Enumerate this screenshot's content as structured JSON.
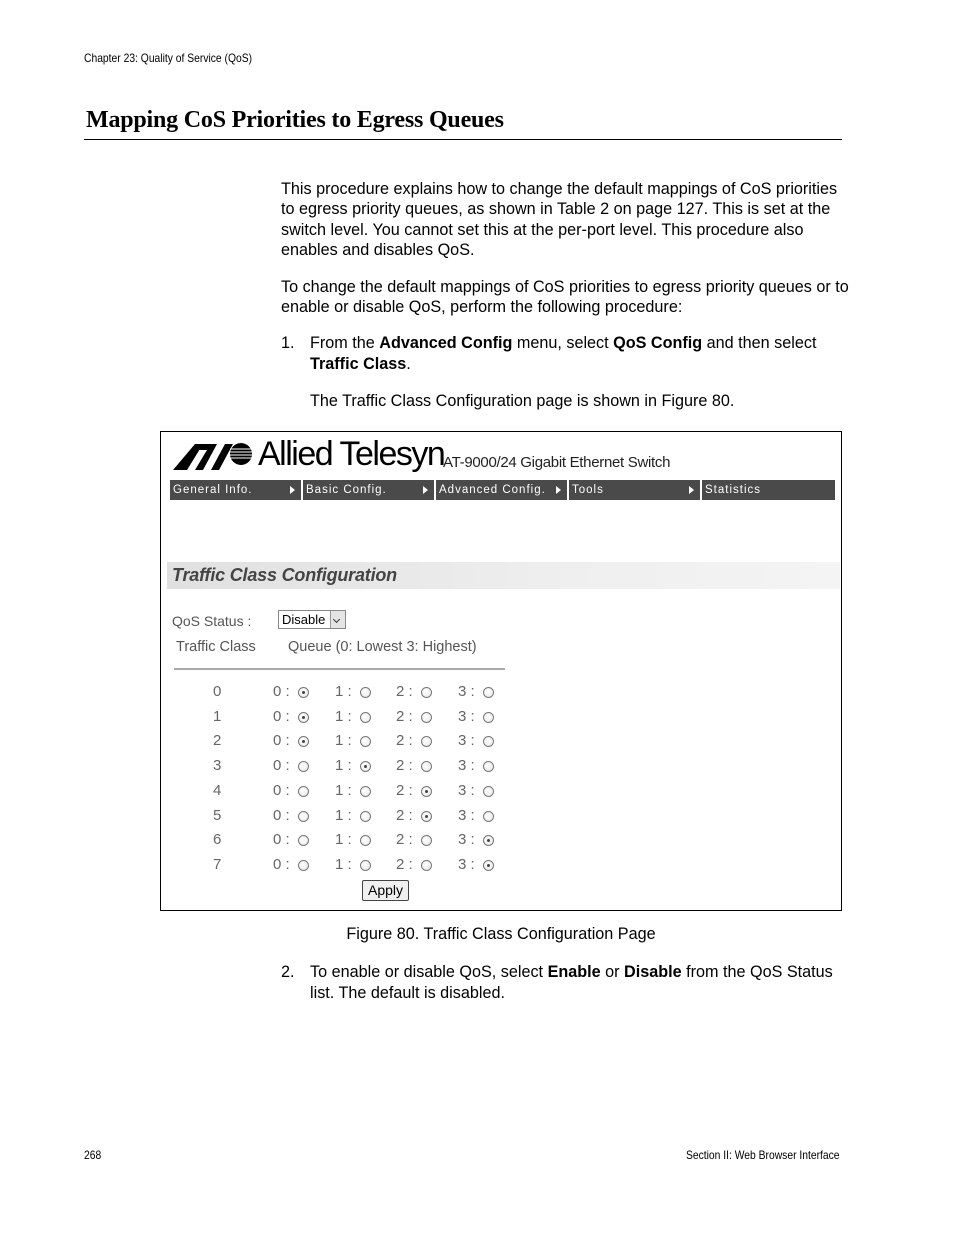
{
  "page": {
    "running_header": "Chapter 23: Quality of Service (QoS)",
    "section_title": "Mapping CoS Priorities to Egress Queues",
    "paragraphs": [
      "This procedure explains how to change the default mappings of CoS priorities to egress priority queues, as shown in Table 2 on page 127. This is set at the switch level. You cannot set this at the per-port level. This procedure also enables and disables QoS.",
      "To change the default mappings of CoS priorities to egress priority queues or to enable or disable QoS, perform the following procedure:"
    ],
    "steps": [
      {
        "number": "1.",
        "parts": [
          {
            "text": "From the ",
            "bold": false
          },
          {
            "text": "Advanced Config",
            "bold": true
          },
          {
            "text": " menu, select ",
            "bold": false
          },
          {
            "text": "QoS Config",
            "bold": true
          },
          {
            "text": " and then select ",
            "bold": false
          },
          {
            "text": "Traffic Class",
            "bold": true
          },
          {
            "text": ".",
            "bold": false
          }
        ],
        "followup": "The Traffic Class Configuration page is shown in Figure 80."
      },
      {
        "number": "2.",
        "parts": [
          {
            "text": "To enable or disable QoS, select ",
            "bold": false
          },
          {
            "text": "Enable",
            "bold": true
          },
          {
            "text": " or ",
            "bold": false
          },
          {
            "text": "Disable",
            "bold": true
          },
          {
            "text": " from the QoS Status list. The default is disabled.",
            "bold": false
          }
        ]
      }
    ],
    "figure_caption": "Figure 80. Traffic Class Configuration Page",
    "footer_left": "268",
    "footer_right": "Section II: Web Browser Interface"
  },
  "figure": {
    "brand": "Allied Telesyn",
    "product": "AT-9000/24 Gigabit Ethernet Switch",
    "nav": [
      {
        "label": "General Info.",
        "has_arrow": true
      },
      {
        "label": "Basic Config.",
        "has_arrow": true
      },
      {
        "label": "Advanced Config.",
        "has_arrow": true
      },
      {
        "label": "Tools",
        "has_arrow": true
      },
      {
        "label": "Statistics",
        "has_arrow": false
      }
    ],
    "panel_title": "Traffic Class Configuration",
    "qos_status_label": "QoS Status :",
    "qos_status_value": "Disable",
    "col_traffic_class": "Traffic Class",
    "col_queue": "Queue  (0: Lowest 3: Highest)",
    "queue_labels": [
      "0 :",
      "1 :",
      "2 :",
      "3 :"
    ],
    "rows": [
      {
        "traffic_class": "0",
        "selected_queue": 0
      },
      {
        "traffic_class": "1",
        "selected_queue": 0
      },
      {
        "traffic_class": "2",
        "selected_queue": 0
      },
      {
        "traffic_class": "3",
        "selected_queue": 1
      },
      {
        "traffic_class": "4",
        "selected_queue": 2
      },
      {
        "traffic_class": "5",
        "selected_queue": 2
      },
      {
        "traffic_class": "6",
        "selected_queue": 3
      },
      {
        "traffic_class": "7",
        "selected_queue": 3
      }
    ],
    "apply_label": "Apply"
  }
}
